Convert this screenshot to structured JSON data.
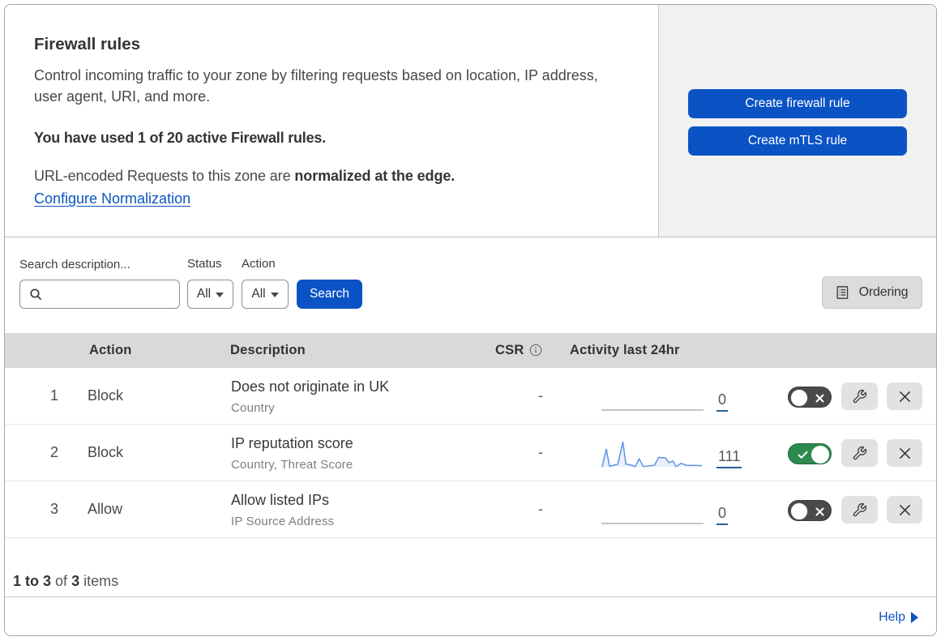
{
  "colors": {
    "accent_blue": "#0b55c9",
    "link_blue": "#0b55c0",
    "toggle_on_green": "#2d8a4e",
    "toggle_off_gray": "#4a4a4a",
    "spark_line": "#6292e3",
    "spark_flat": "#b3b3b3",
    "count_underline": "#2a5e96"
  },
  "header": {
    "title": "Firewall rules",
    "description": "Control incoming traffic to your zone by filtering requests based on location, IP address, user agent, URI, and more.",
    "usage": "You have used 1 of 20 active Firewall rules.",
    "normalization_text": "URL-encoded Requests to this zone are",
    "normalization_bold": "normalized at the edge.",
    "normalization_link": "Configure Normalization"
  },
  "cta": {
    "create_firewall_rule": "Create firewall rule",
    "create_mtls_rule": "Create mTLS rule"
  },
  "filters": {
    "search_label": "Search description...",
    "search_value": "",
    "status_label": "Status",
    "status_value": "All",
    "action_label": "Action",
    "action_value": "All",
    "search_button": "Search",
    "ordering_button": "Ordering"
  },
  "table": {
    "columns": {
      "action": "Action",
      "description": "Description",
      "csr": "CSR",
      "activity": "Activity last 24hr"
    },
    "rows": [
      {
        "index": "1",
        "action": "Block",
        "description": "Does not originate in UK",
        "criteria": "Country",
        "csr": "-",
        "activity_count": "0",
        "enabled": false,
        "activity_points": [
          [
            0,
            0
          ],
          [
            1,
            0
          ]
        ]
      },
      {
        "index": "2",
        "action": "Block",
        "description": "IP reputation score",
        "criteria": "Country, Threat Score",
        "csr": "-",
        "activity_count": "111",
        "enabled": true,
        "activity_points": [
          [
            0.008,
            0.01
          ],
          [
            0.048,
            0.7
          ],
          [
            0.08,
            0.02
          ],
          [
            0.16,
            0.1
          ],
          [
            0.21,
            0.99
          ],
          [
            0.24,
            0.11
          ],
          [
            0.3,
            0.06
          ],
          [
            0.33,
            0.0
          ],
          [
            0.37,
            0.32
          ],
          [
            0.41,
            0.01
          ],
          [
            0.52,
            0.06
          ],
          [
            0.56,
            0.37
          ],
          [
            0.63,
            0.35
          ],
          [
            0.66,
            0.16
          ],
          [
            0.7,
            0.23
          ],
          [
            0.73,
            0.01
          ],
          [
            0.78,
            0.14
          ],
          [
            0.83,
            0.06
          ],
          [
            0.98,
            0.05
          ]
        ]
      },
      {
        "index": "3",
        "action": "Allow",
        "description": "Allow listed IPs",
        "criteria": "IP Source Address",
        "csr": "-",
        "activity_count": "0",
        "enabled": false,
        "activity_points": [
          [
            0,
            0
          ],
          [
            1,
            0
          ]
        ]
      }
    ]
  },
  "footer": {
    "range": "1 to 3",
    "of_label": "of",
    "total": "3",
    "items_label": "items"
  },
  "help": {
    "label": "Help"
  }
}
